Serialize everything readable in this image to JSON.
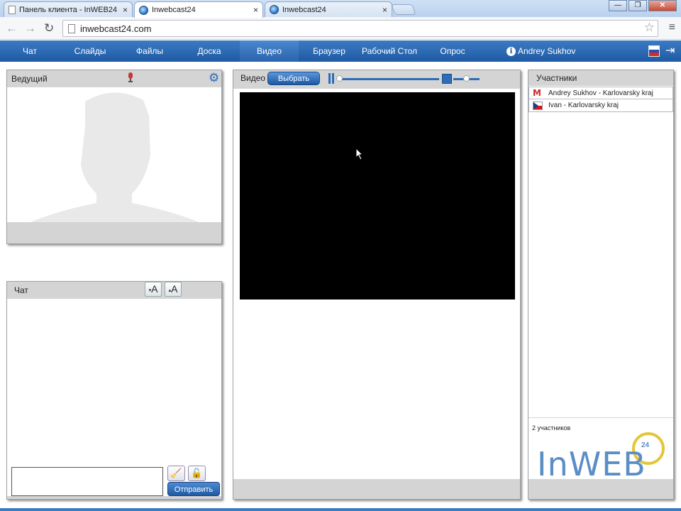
{
  "browser": {
    "tabs": [
      {
        "title": "Панель клиента - InWEB24",
        "close": "×",
        "active": false
      },
      {
        "title": "Inwebcast24",
        "close": "×",
        "active": true
      },
      {
        "title": "Inwebcast24",
        "close": "×",
        "active": false
      }
    ],
    "url": "inwebcast24.com",
    "window_controls": {
      "minimize": "—",
      "maximize": "❐",
      "close": "✕"
    },
    "nav": {
      "back": "←",
      "forward": "→",
      "reload": "↻",
      "star": "☆",
      "menu": "≡"
    }
  },
  "appbar": {
    "items": [
      {
        "label": "Чат"
      },
      {
        "label": "Слайды"
      },
      {
        "label": "Файлы"
      },
      {
        "label": "Доска"
      },
      {
        "label": "Видео",
        "active": true
      },
      {
        "label": "Браузер"
      },
      {
        "label": "Рабочий Стол"
      },
      {
        "label": "Опрос"
      }
    ],
    "user_info_icon": "i",
    "user_name": "Andrey Sukhov",
    "exit_icon": "⇥",
    "colors": {
      "bar": "#2a64ad",
      "accent": "#2d6cb8"
    }
  },
  "presenter": {
    "title": "Ведущий",
    "settings_icon": "⚙"
  },
  "chat": {
    "title": "Чат",
    "font_smaller": "A",
    "font_larger": "A",
    "clear_icon": "🧹",
    "lock_icon": "🔓",
    "input_value": "",
    "send_label": "Отправить"
  },
  "video": {
    "title": "Видео",
    "choose_label": "Выбрать",
    "playback_position": 0,
    "volume_level": 0.5
  },
  "participants": {
    "title": "Участники",
    "list": [
      {
        "name": "Andrey Sukhov - Karlovarsky kraj",
        "icon": "M"
      },
      {
        "name": "Ivan - Karlovarsky kraj",
        "icon": "cz-flag"
      }
    ],
    "count_text": "2 участников",
    "logo_text": "InWEB",
    "logo_number": "24"
  }
}
